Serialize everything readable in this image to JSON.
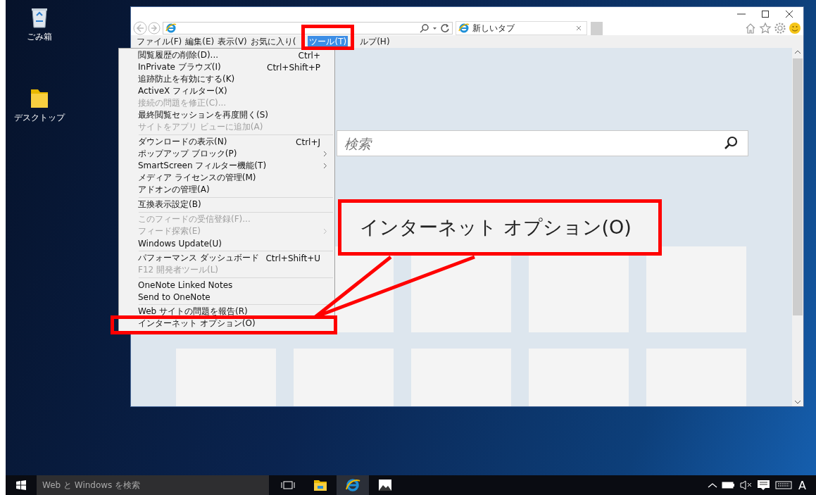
{
  "desktop_icons": [
    {
      "label": "ごみ箱",
      "kind": "recycle-bin"
    },
    {
      "label": "デスクトップ",
      "kind": "folder"
    }
  ],
  "browser": {
    "tab": {
      "title": "新しいタブ"
    },
    "menubar": [
      {
        "label": "ファイル(F)",
        "selected": false
      },
      {
        "label": "編集(E)",
        "selected": false
      },
      {
        "label": "表示(V)",
        "selected": false
      },
      {
        "label": "お気に入り(",
        "selected": false
      },
      {
        "label": "ツール(T)",
        "selected": true
      },
      {
        "label": "ルプ(H)",
        "selected": false
      }
    ],
    "page_search": {
      "placeholder": "検索"
    }
  },
  "tools_menu": {
    "groups": [
      [
        {
          "label": "閲覧履歴の削除(D)...",
          "shortcut": "Ctrl+",
          "disabled": false,
          "submenu": false
        },
        {
          "label": "InPrivate ブラウズ(I)",
          "shortcut": "Ctrl+Shift+P",
          "disabled": false,
          "submenu": false
        },
        {
          "label": "追跡防止を有効にする(K)",
          "disabled": false,
          "submenu": false
        },
        {
          "label": "ActiveX フィルター(X)",
          "disabled": false,
          "submenu": false
        },
        {
          "label": "接続の問題を修正(C)...",
          "disabled": true,
          "submenu": false
        },
        {
          "label": "最終閲覧セッションを再度開く(S)",
          "disabled": false,
          "submenu": false
        },
        {
          "label": "サイトをアプリ ビューに追加(A)",
          "disabled": true,
          "submenu": false
        }
      ],
      [
        {
          "label": "ダウンロードの表示(N)",
          "shortcut": "Ctrl+J",
          "disabled": false,
          "submenu": false
        },
        {
          "label": "ポップアップ ブロック(P)",
          "disabled": false,
          "submenu": true
        },
        {
          "label": "SmartScreen フィルター機能(T)",
          "disabled": false,
          "submenu": true
        },
        {
          "label": "メディア ライセンスの管理(M)",
          "disabled": false,
          "submenu": false
        },
        {
          "label": "アドオンの管理(A)",
          "disabled": false,
          "submenu": false
        }
      ],
      [
        {
          "label": "互換表示設定(B)",
          "disabled": false,
          "submenu": false
        }
      ],
      [
        {
          "label": "このフィードの受信登録(F)...",
          "disabled": true,
          "submenu": false
        },
        {
          "label": "フィード探索(E)",
          "disabled": true,
          "submenu": true
        },
        {
          "label": "Windows Update(U)",
          "disabled": false,
          "submenu": false
        }
      ],
      [
        {
          "label": "パフォーマンス ダッシュボード",
          "shortcut": "Ctrl+Shift+U",
          "disabled": false,
          "submenu": false
        },
        {
          "label": "F12 開発者ツール(L)",
          "disabled": true,
          "submenu": false
        }
      ],
      [
        {
          "label": "OneNote Linked Notes",
          "disabled": false,
          "submenu": false
        },
        {
          "label": "Send to OneNote",
          "disabled": false,
          "submenu": false
        }
      ],
      [
        {
          "label": "Web サイトの問題を報告(R)",
          "disabled": false,
          "submenu": false
        },
        {
          "label": "インターネット オプション(O)",
          "disabled": false,
          "submenu": false
        }
      ]
    ]
  },
  "callout": {
    "text": "インターネット オプション(O)"
  },
  "taskbar": {
    "search": {
      "placeholder": "Web と Windows を検索"
    },
    "apps": [
      {
        "kind": "task-view",
        "selected": false
      },
      {
        "kind": "explorer",
        "selected": false
      },
      {
        "kind": "ie",
        "selected": true
      },
      {
        "kind": "photos",
        "selected": false
      }
    ],
    "ime": "A"
  }
}
